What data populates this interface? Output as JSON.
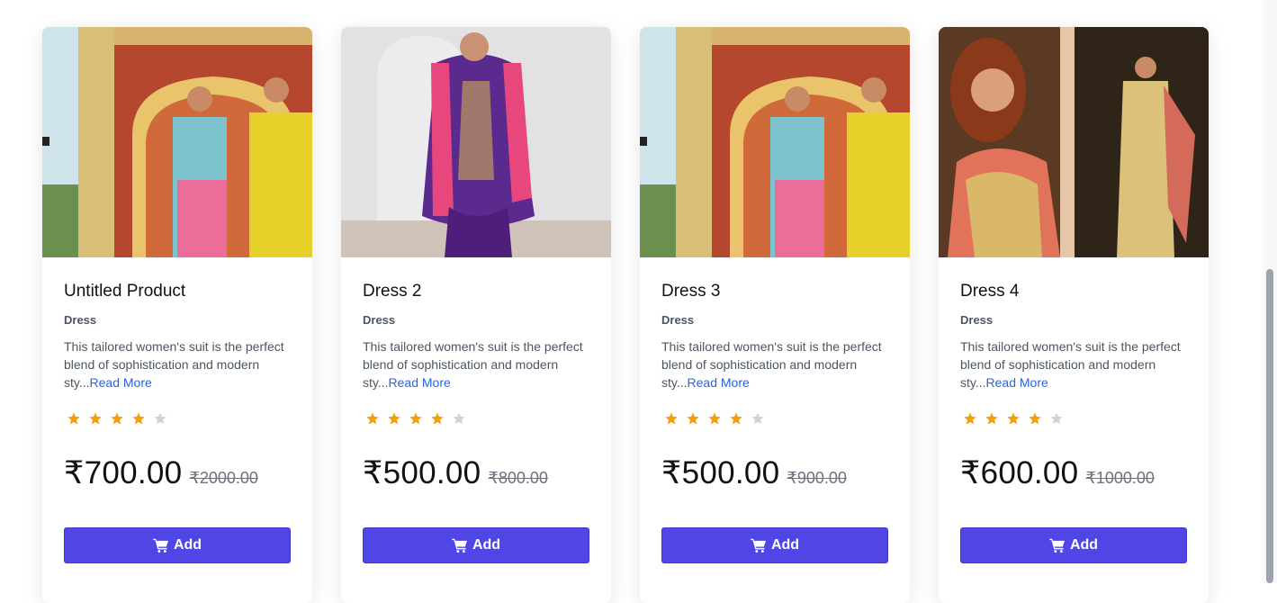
{
  "products": [
    {
      "title": "Untitled Product",
      "category": "Dress",
      "description": "This tailored women's suit is the perfect blend of sophistication and modern sty...",
      "read_more": "Read More",
      "rating": 4,
      "rating_max": 5,
      "price": "₹700.00",
      "original_price": "₹2000.00",
      "add_label": "Add",
      "image_icon": "product-photo"
    },
    {
      "title": "Dress 2",
      "category": "Dress",
      "description": "This tailored women's suit is the perfect blend of sophistication and modern sty...",
      "read_more": "Read More",
      "rating": 4,
      "rating_max": 5,
      "price": "₹500.00",
      "original_price": "₹800.00",
      "add_label": "Add",
      "image_icon": "product-photo"
    },
    {
      "title": "Dress 3",
      "category": "Dress",
      "description": "This tailored women's suit is the perfect blend of sophistication and modern sty...",
      "read_more": "Read More",
      "rating": 4,
      "rating_max": 5,
      "price": "₹500.00",
      "original_price": "₹900.00",
      "add_label": "Add",
      "image_icon": "product-photo"
    },
    {
      "title": "Dress 4",
      "category": "Dress",
      "description": "This tailored women's suit is the perfect blend of sophistication and modern sty...",
      "read_more": "Read More",
      "rating": 4,
      "rating_max": 5,
      "price": "₹600.00",
      "original_price": "₹1000.00",
      "add_label": "Add",
      "image_icon": "product-photo"
    }
  ],
  "colors": {
    "accent": "#4f46e5",
    "star_filled": "#f59e0b",
    "star_empty": "#d1d5db",
    "link": "#2563eb"
  }
}
